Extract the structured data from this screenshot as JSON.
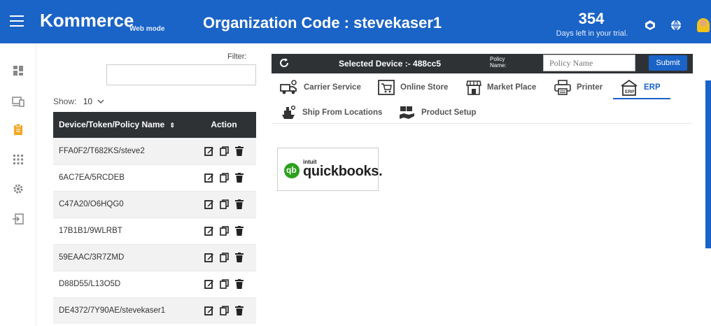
{
  "header": {
    "brand": "Kommerce",
    "mode": "Web mode",
    "organization": "Organization Code : stevekaser1",
    "trial_days": "354",
    "trial_text": "Days left in your trial."
  },
  "devices": {
    "filter_label": "Filter:",
    "show_label": "Show:",
    "show_value": "10",
    "columns": [
      "Device/Token/Policy Name",
      "Action"
    ],
    "rows": [
      "FFA0F2/T682KS/steve2",
      "6AC7EA/5RCDEB",
      "C47A20/O6HQG0",
      "17B1B1/9WLRBT",
      "59EAAC/3R7ZMD",
      "D88D55/L13O5D",
      "DE4372/7Y90AE/stevekaser1"
    ]
  },
  "device_bar": {
    "selected_device": "Selected Device :- 488cc5",
    "policy_label": "Policy Name:",
    "policy_placeholder": "Policy Name",
    "submit": "Submit"
  },
  "tabs": [
    {
      "label": "Carrier Service",
      "icon": "truck-icon"
    },
    {
      "label": "Online Store",
      "icon": "cart-icon"
    },
    {
      "label": "Market Place",
      "icon": "store-icon"
    },
    {
      "label": "Printer",
      "icon": "printer-icon"
    },
    {
      "label": "ERP",
      "icon": "erp-icon",
      "active": true
    },
    {
      "label": "Ship From Locations",
      "icon": "ship-icon"
    },
    {
      "label": "Product Setup",
      "icon": "product-icon"
    }
  ],
  "erp": {
    "logo_small": "intuit",
    "logo_text": "quickbooks."
  },
  "colors": {
    "primary": "#1a63c7",
    "dark": "#2f3235",
    "qb_green": "#2ca01c"
  }
}
